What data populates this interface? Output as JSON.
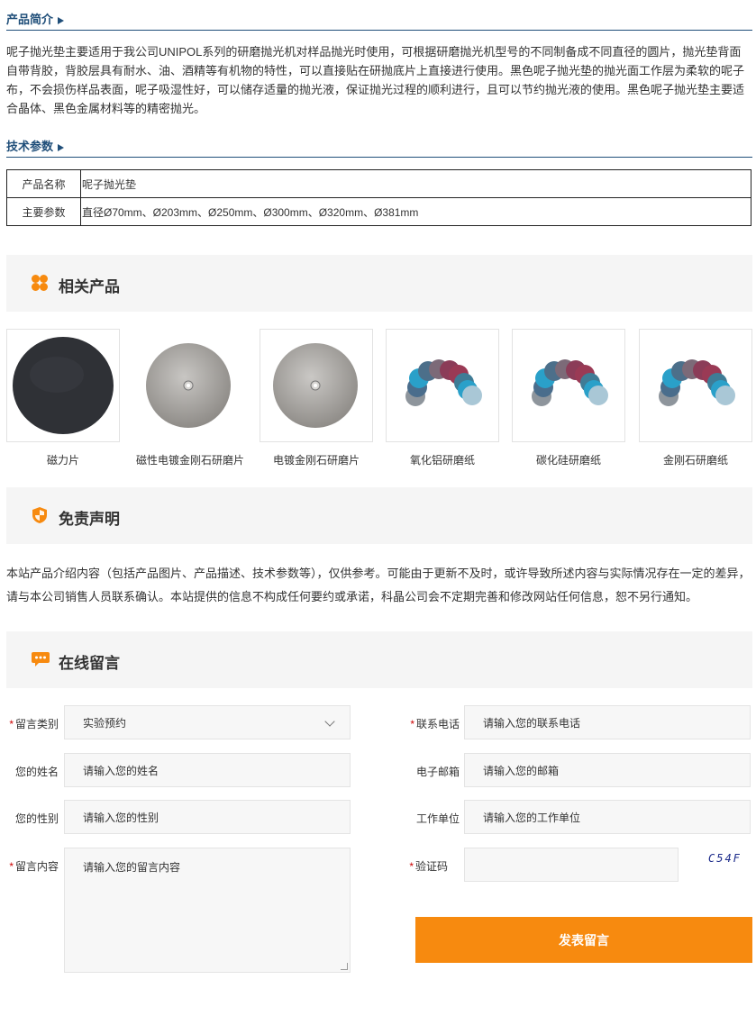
{
  "intro": {
    "heading": "产品简介",
    "text": "呢子抛光垫主要适用于我公司UNIPOL系列的研磨抛光机对样品抛光时使用，可根据研磨抛光机型号的不同制备成不同直径的圆片，抛光垫背面自带背胶，背胶层具有耐水、油、酒精等有机物的特性，可以直接贴在研抛底片上直接进行使用。黑色呢子抛光垫的抛光面工作层为柔软的呢子布，不会损伤样品表面，呢子吸湿性好，可以储存适量的抛光液，保证抛光过程的顺利进行，且可以节约抛光液的使用。黑色呢子抛光垫主要适合晶体、黑色金属材料等的精密抛光。"
  },
  "params": {
    "heading": "技术参数",
    "rows": [
      {
        "key": "产品名称",
        "value": "呢子抛光垫"
      },
      {
        "key": "主要参数",
        "value": "直径Ø70mm、Ø203mm、Ø250mm、Ø300mm、Ø320mm、Ø381mm"
      }
    ]
  },
  "related": {
    "title": "相关产品",
    "icon": "clover-grid-icon",
    "accent": "#f78a0f",
    "products": [
      {
        "name": "磁力片"
      },
      {
        "name": "磁性电镀金刚石研磨片"
      },
      {
        "name": "电镀金刚石研磨片"
      },
      {
        "name": "氧化铝研磨纸"
      },
      {
        "name": "碳化硅研磨纸"
      },
      {
        "name": "金刚石研磨纸"
      }
    ]
  },
  "disclaimer": {
    "title": "免责声明",
    "icon": "shield-icon",
    "text": "本站产品介绍内容（包括产品图片、产品描述、技术参数等），仅供参考。可能由于更新不及时，或许导致所述内容与实际情况存在一定的差异，请与本公司销售人员联系确认。本站提供的信息不构成任何要约或承诺，科晶公司会不定期完善和修改网站任何信息，恕不另行通知。"
  },
  "message": {
    "title": "在线留言",
    "icon": "chat-bubble-icon",
    "fields": {
      "category": {
        "label": "留言类别",
        "value": "实验预约"
      },
      "phone": {
        "label": "联系电话",
        "placeholder": "请输入您的联系电话"
      },
      "name": {
        "label": "您的姓名",
        "placeholder": "请输入您的姓名"
      },
      "email": {
        "label": "电子邮箱",
        "placeholder": "请输入您的邮箱"
      },
      "gender": {
        "label": "您的性别",
        "placeholder": "请输入您的性别"
      },
      "company": {
        "label": "工作单位",
        "placeholder": "请输入您的工作单位"
      },
      "content": {
        "label": "留言内容",
        "placeholder": "请输入您的留言内容"
      },
      "captcha": {
        "label": "验证码",
        "code": "C54F"
      }
    },
    "required_mark": "*",
    "submit": "发表留言"
  }
}
